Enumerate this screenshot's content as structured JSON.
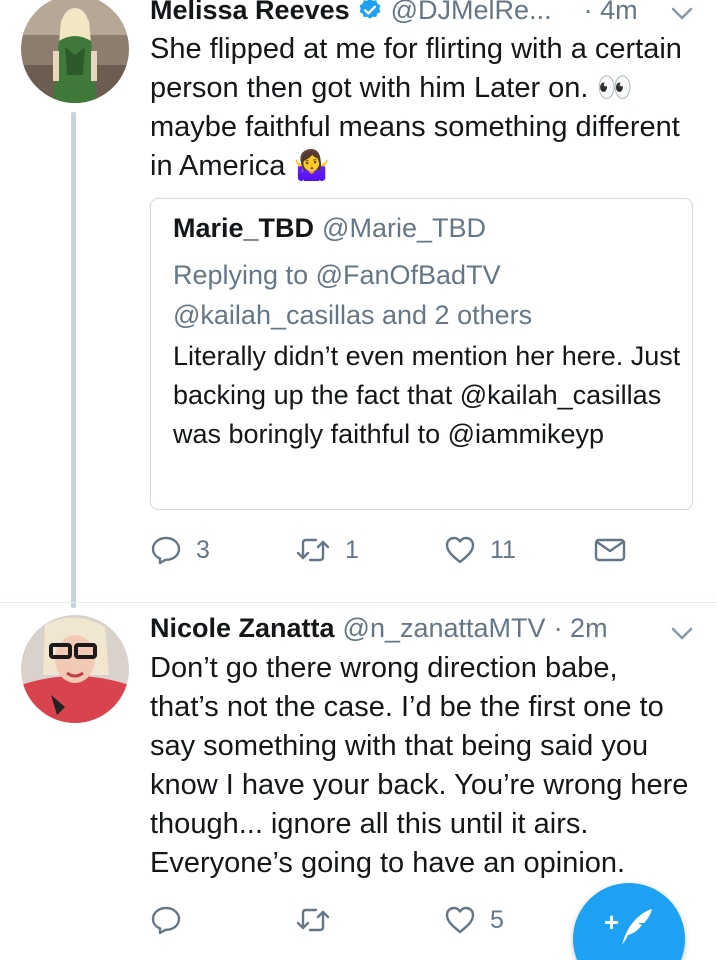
{
  "tweet1": {
    "name": "Melissa Reeves",
    "handle": "@DJMelRe...",
    "time": "· 4m",
    "text": "She flipped at me for flirting with a certain person then got with him Later on. 👀 maybe faithful means something different in America 🤷‍♀",
    "quote": {
      "name": "Marie_TBD",
      "handle": "@Marie_TBD",
      "replying_prefix": "Replying to ",
      "replying_mention": "@FanOfBadTV",
      "replying_rest": "@kailah_casillas and 2 others",
      "text": "Literally didn’t even mention her here. Just backing up the fact that @kailah_casillas was boringly faithful to @iammikeyp"
    },
    "actions": {
      "replies": "3",
      "retweets": "1",
      "likes": "11"
    }
  },
  "tweet2": {
    "name": "Nicole Zanatta",
    "handle": "@n_zanattaMTV",
    "time": "· 2m",
    "text": "Don’t go there wrong direction babe, that’s not the case. I’d be the first one to say something with that being said you know I have your back. You’re wrong here though... ignore all this until it airs. Everyone’s going to have an opinion.",
    "actions": {
      "replies": "",
      "retweets": "",
      "likes": "5"
    }
  },
  "compose_label": "+",
  "colors": {
    "accent": "#1da1f2",
    "muted": "#657786",
    "thread_line": "#c7d4dd",
    "text": "#14171a"
  },
  "icons": [
    "verified-badge-icon",
    "chevron-down-icon",
    "reply-icon",
    "retweet-icon",
    "like-icon",
    "message-icon",
    "compose-feather-icon"
  ]
}
